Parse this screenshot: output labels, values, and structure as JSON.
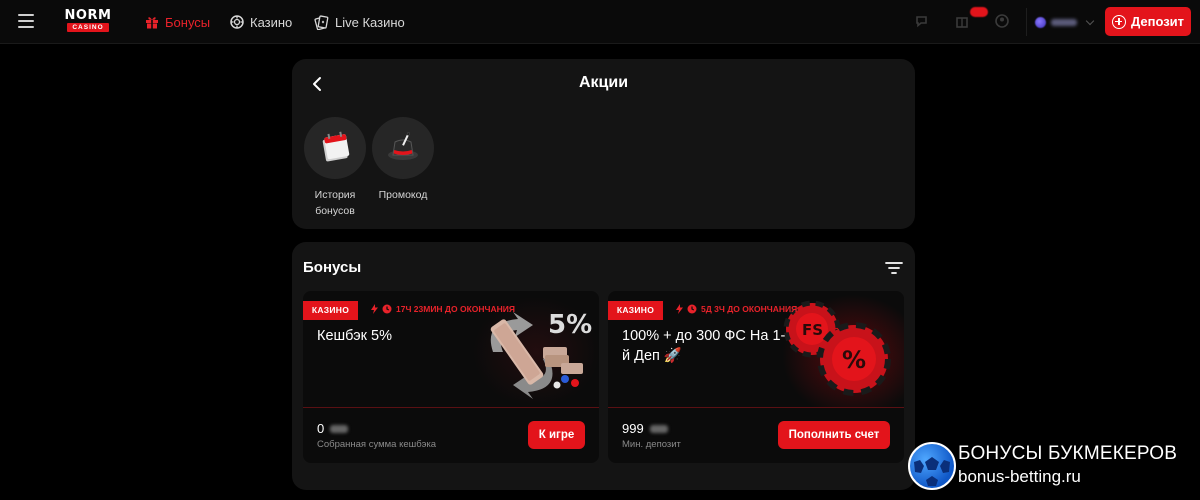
{
  "header": {
    "logo": {
      "top": "NORM",
      "sub": "CASINO"
    },
    "nav": [
      {
        "label": "Бонусы",
        "active": true
      },
      {
        "label": "Казино",
        "active": false
      },
      {
        "label": "Live Казино",
        "active": false
      }
    ],
    "deposit_label": "Депозит"
  },
  "promotions": {
    "title": "Акции",
    "shortcuts": [
      {
        "label": "История бонусов",
        "icon": "calendar-icon"
      },
      {
        "label": "Промокод",
        "icon": "magic-hat-icon"
      }
    ]
  },
  "bonuses": {
    "title": "Бонусы",
    "cards": [
      {
        "tag": "КАЗИНО",
        "timer": "17Ч 23МИН ДО ОКОНЧАНИЯ",
        "title": "Кешбэк 5%",
        "value": "0",
        "caption": "Собранная сумма кешбэка",
        "button": "К игре",
        "art_text": "5%"
      },
      {
        "tag": "КАЗИНО",
        "timer": "5Д 3Ч ДО ОКОНЧАНИЯ",
        "title": "100% + до 300 ФС На 1-й Деп 🚀",
        "value": "999",
        "caption": "Мин. депозит",
        "button": "Пополнить счет",
        "art_chip_1": "FS",
        "art_chip_2": "%"
      }
    ]
  },
  "watermark": {
    "title": "БОНУСЫ БУКМЕКЕРОВ",
    "url": "bonus-betting.ru"
  },
  "colors": {
    "accent": "#e3141b",
    "background": "#000000",
    "panel": "#141414",
    "card": "#0b0b0b"
  }
}
